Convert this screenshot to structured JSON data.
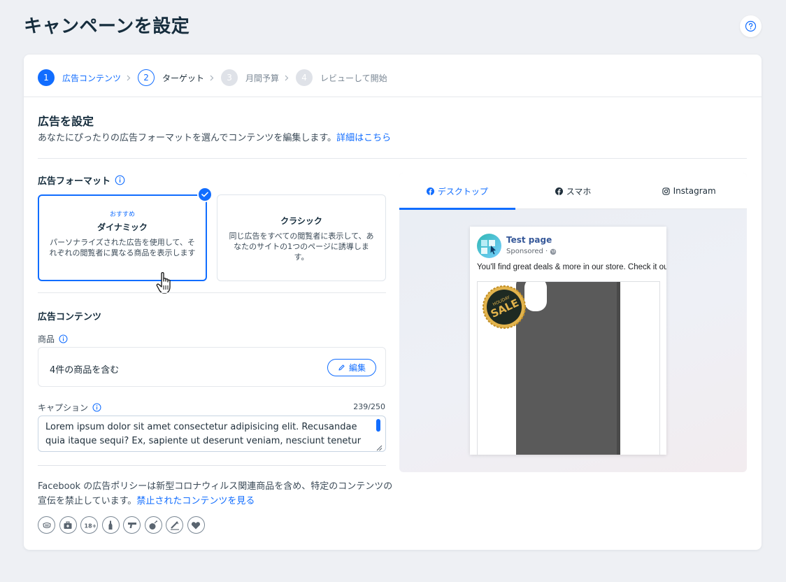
{
  "page": {
    "title": "キャンペーンを設定"
  },
  "stepper": {
    "steps": [
      {
        "num": "1",
        "label": "広告コンテンツ"
      },
      {
        "num": "2",
        "label": "ターゲット"
      },
      {
        "num": "3",
        "label": "月間予算"
      },
      {
        "num": "4",
        "label": "レビューして開始"
      }
    ]
  },
  "ad_setup": {
    "title": "広告を設定",
    "description": "あなたにぴったりの広告フォーマットを選んでコンテンツを編集します。",
    "learn_more": "詳細はこちら"
  },
  "format": {
    "label": "広告フォーマット",
    "options": [
      {
        "badge": "おすすめ",
        "name": "ダイナミック",
        "description": "パーソナライズされた広告を使用して、それぞれの閲覧者に異なる商品を表示します"
      },
      {
        "name": "クラシック",
        "description": "同じ広告をすべての閲覧者に表示して、あなたのサイトの1つのページに誘導します。"
      }
    ]
  },
  "content": {
    "title": "広告コンテンツ",
    "products_label": "商品",
    "products_value": "4件の商品を含む",
    "edit_label": "編集",
    "caption_label": "キャプション",
    "caption_count": "239/250",
    "caption_text": "Lorem ipsum dolor sit amet consectetur adipisicing elit. Recusandae quia itaque sequi? Ex, sapiente ut deserunt veniam, nesciunt tenetur"
  },
  "policy": {
    "text": "Facebook の広告ポリシーは新型コロナウィルス関連商品を含め、特定のコンテンツの宣伝を禁止しています。",
    "link": "禁止されたコンテンツを見る",
    "icons": [
      "mask-icon",
      "medical-kit-icon",
      "adult-18-icon",
      "alcohol-icon",
      "weapon-icon",
      "explosive-icon",
      "drugs-icon",
      "adult-content-icon"
    ]
  },
  "preview": {
    "tabs": [
      {
        "icon": "facebook-icon",
        "label": "デスクトップ"
      },
      {
        "icon": "facebook-icon",
        "label": "スマホ"
      },
      {
        "icon": "instagram-icon",
        "label": "Instagram"
      }
    ],
    "post": {
      "page_name": "Test page",
      "sponsored": "Sponsored ·",
      "text": "You'll find great deals & more in our store. Check it out!",
      "badge_top": "HOLIDAY",
      "badge_main": "SALE"
    }
  },
  "colors": {
    "accent": "#116dff",
    "background": "#eef0f4",
    "text": "#162d3d"
  }
}
